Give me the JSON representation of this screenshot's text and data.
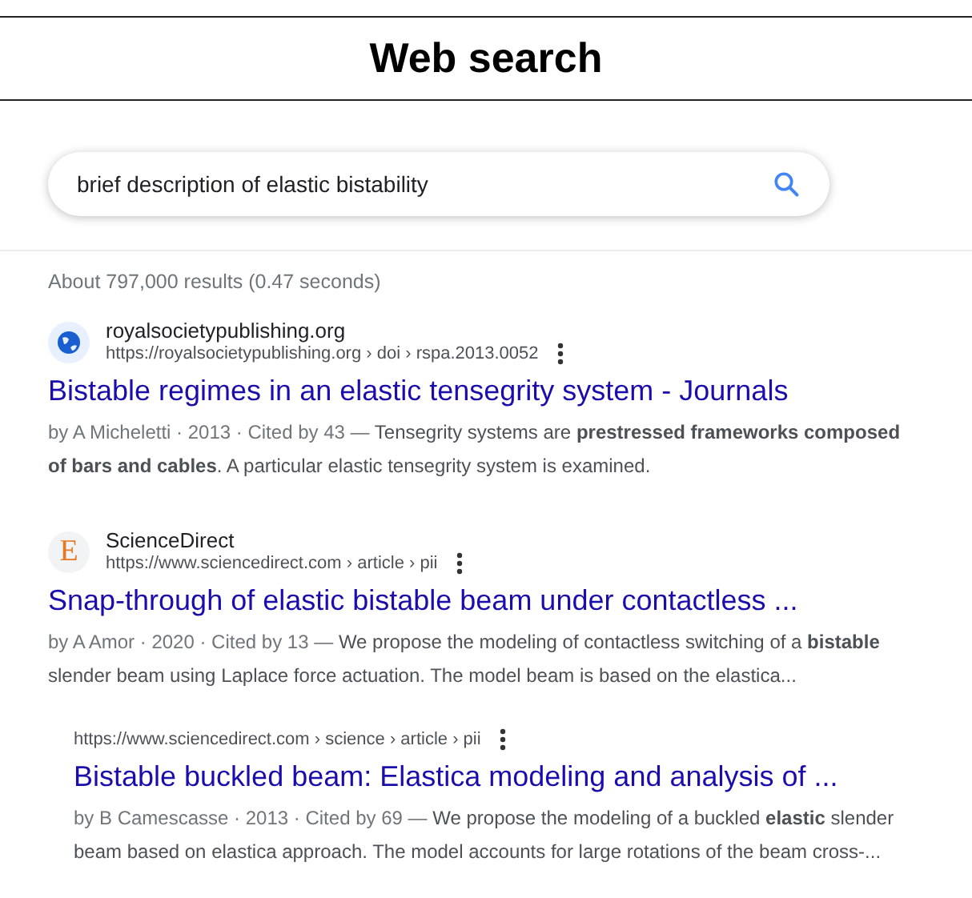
{
  "header": {
    "title": "Web search"
  },
  "search": {
    "value": "brief description of elastic bistability"
  },
  "stats": "About 797,000 results (0.47 seconds)",
  "results": [
    {
      "indented": false,
      "favicon": {
        "kind": "globe"
      },
      "site": "royalsocietypublishing.org",
      "url": "https://royalsocietypublishing.org › doi › rspa.2013.0052",
      "title": "Bistable regimes in an elastic tensegrity system - Journals",
      "meta": "by A Micheletti · 2013 · Cited by 43 — ",
      "snippet": "Tensegrity systems are **prestressed frameworks composed of bars and cables**. A particular elastic tensegrity system is examined."
    },
    {
      "indented": false,
      "favicon": {
        "kind": "letter",
        "text": "E"
      },
      "site": "ScienceDirect",
      "url": "https://www.sciencedirect.com › article › pii",
      "title": "Snap-through of elastic bistable beam under contactless ...",
      "meta": "by A Amor · 2020 · Cited by 13 — ",
      "snippet": "We propose the modeling of contactless switching of a **bistable** slender beam using Laplace force actuation. The model beam is based on the elastica..."
    },
    {
      "indented": true,
      "url": "https://www.sciencedirect.com › science › article › pii",
      "title": "Bistable buckled beam: Elastica modeling and analysis of ...",
      "meta": "by B Camescasse · 2013 · Cited by 69 — ",
      "snippet": "We propose the modeling of a buckled **elastic** slender beam based on elastica approach. The model accounts for large rotations of the beam cross-..."
    }
  ]
}
